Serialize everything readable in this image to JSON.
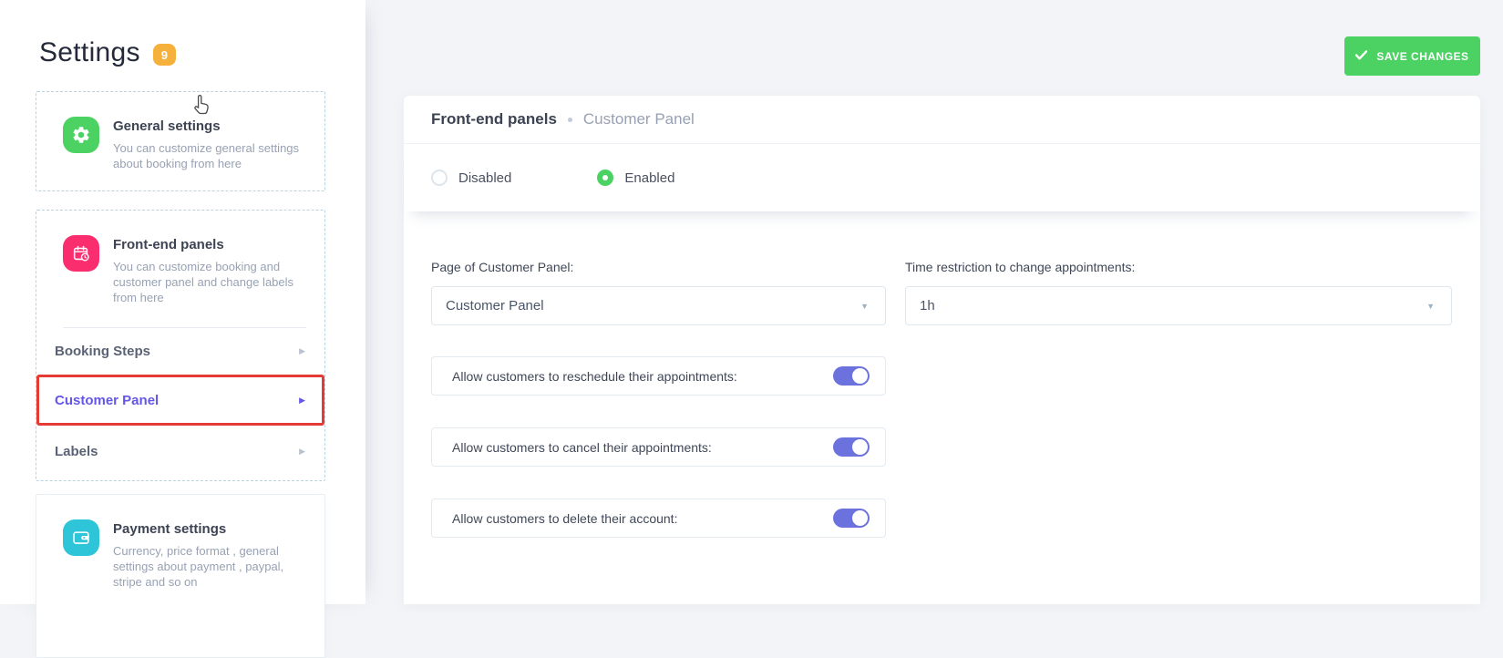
{
  "colors": {
    "green": "#4cd263",
    "orange": "#f6b13c",
    "pink": "#fa2e6e",
    "teal": "#2fc5d9",
    "purple": "#6c72dd",
    "purple_text": "#6456e8",
    "red": "#e53b34"
  },
  "sidebar": {
    "title": "Settings",
    "badge": "9",
    "cards": [
      {
        "icon": "gear-icon",
        "title": "General settings",
        "desc": "You can customize general settings about booking from here"
      },
      {
        "icon": "calendar-clock-icon",
        "title": "Front-end panels",
        "desc": "You can customize booking and customer panel and change labels from here",
        "items": [
          {
            "label": "Booking Steps",
            "active": false
          },
          {
            "label": "Customer Panel",
            "active": true
          },
          {
            "label": "Labels",
            "active": false
          }
        ]
      },
      {
        "icon": "wallet-icon",
        "title": "Payment settings",
        "desc": "Currency, price format , general settings about payment , paypal, stripe and so on"
      }
    ]
  },
  "header": {
    "save_label": "SAVE CHANGES"
  },
  "panel": {
    "breadcrumb_primary": "Front-end panels",
    "breadcrumb_secondary": "Customer Panel",
    "radio_disabled": "Disabled",
    "radio_enabled": "Enabled",
    "enabled_selected": true,
    "fields": {
      "page_label": "Page of Customer Panel:",
      "page_value": "Customer Panel",
      "time_label": "Time restriction to change appointments:",
      "time_value": "1h"
    },
    "toggles": [
      {
        "label": "Allow customers to reschedule their appointments:",
        "on": true
      },
      {
        "label": "Allow customers to cancel their appointments:",
        "on": true
      },
      {
        "label": "Allow customers to delete their account:",
        "on": true
      }
    ]
  }
}
